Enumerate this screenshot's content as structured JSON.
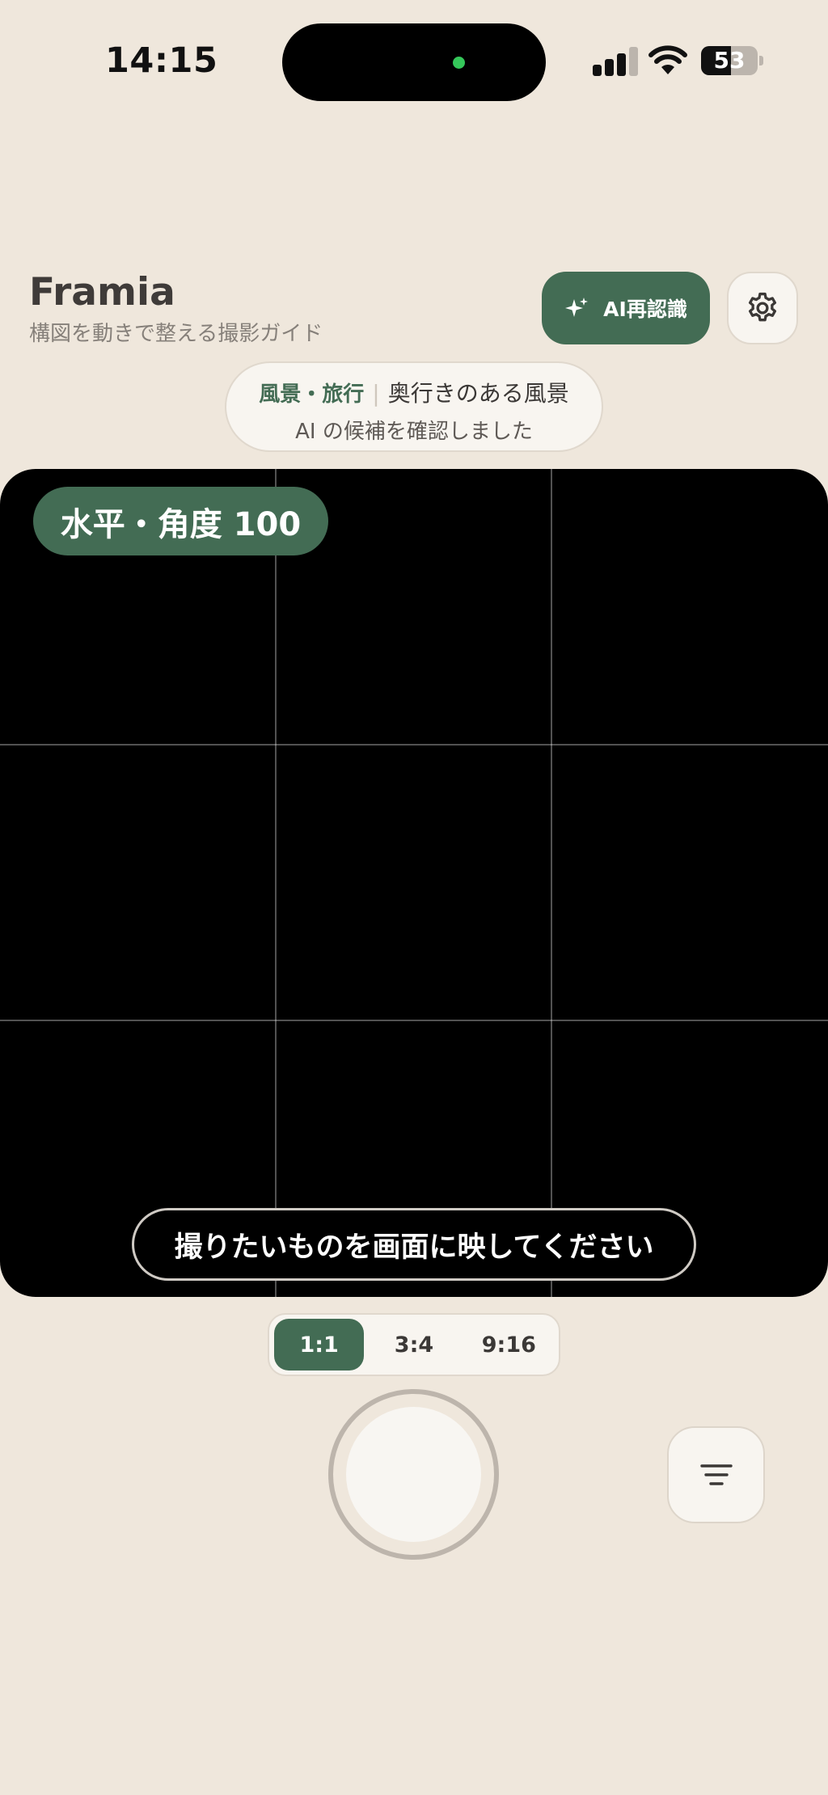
{
  "status_bar": {
    "time": "14:15",
    "battery": "53",
    "icons": [
      "signal-icon",
      "wifi-icon",
      "battery-icon"
    ]
  },
  "header": {
    "title": "Framia",
    "subtitle": "構図を動きで整える撮影ガイド",
    "ai_button_label": "AI再認識",
    "ai_button_icon": "sparkle-icon",
    "settings_icon": "gear-icon"
  },
  "recognition": {
    "category": "風景・旅行",
    "separator": "|",
    "scene": "奥行きのある風景",
    "status": "AI の候補を確認しました"
  },
  "preview": {
    "score_label": "水平・角度 100",
    "hint": "撮りたいものを画面に映してください"
  },
  "ratios": {
    "options": [
      "1:1",
      "3:4",
      "9:16"
    ],
    "selected": "1:1"
  },
  "controls": {
    "shutter_icon": "shutter-button",
    "menu_icon": "filter-menu-icon"
  },
  "colors": {
    "background": "#efe7dc",
    "accent": "#436c54",
    "surface": "#f8f5f0",
    "preview": "#000000"
  }
}
